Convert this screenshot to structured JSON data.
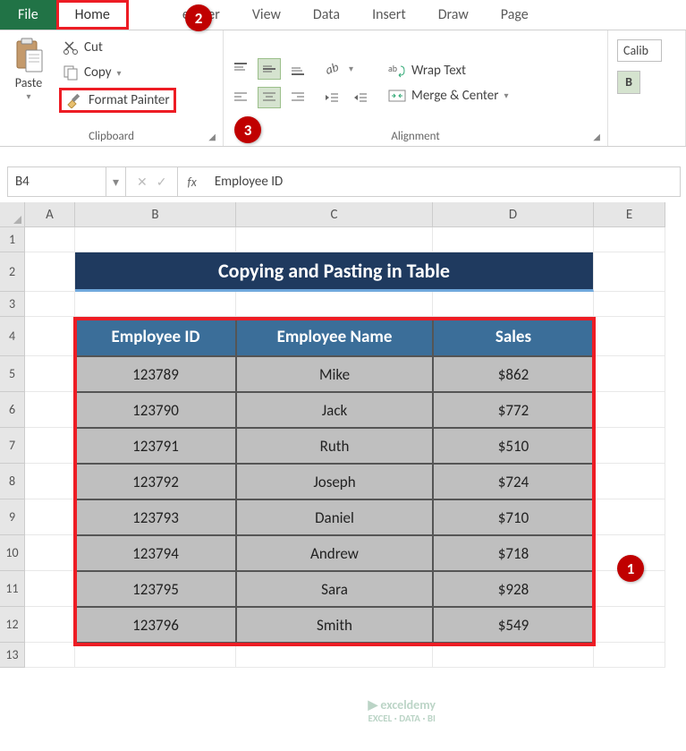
{
  "tabs": {
    "file": "File",
    "home": "Home",
    "developer": "eloper",
    "view": "View",
    "data": "Data",
    "insert": "Insert",
    "draw": "Draw",
    "page": "Page"
  },
  "clipboard": {
    "paste": "Paste",
    "cut": "Cut",
    "copy": "Copy",
    "formatPainter": "Format Painter",
    "groupLabel": "Clipboard"
  },
  "alignment": {
    "wrapText": "Wrap Text",
    "mergeCenter": "Merge & Center",
    "groupLabel": "Alignment"
  },
  "font": {
    "name": "Calib",
    "bold": "B"
  },
  "nameBox": "B4",
  "formulaValue": "Employee ID",
  "columns": [
    "A",
    "B",
    "C",
    "D",
    "E"
  ],
  "rowNumbers": [
    "1",
    "2",
    "3",
    "4",
    "5",
    "6",
    "7",
    "8",
    "9",
    "10",
    "11",
    "12",
    "13"
  ],
  "titleText": "Copying and Pasting in Table",
  "tableHeaders": {
    "id": "Employee ID",
    "name": "Employee Name",
    "sales": "Sales"
  },
  "tableData": [
    {
      "id": "123789",
      "name": "Mike",
      "sales": "$862"
    },
    {
      "id": "123790",
      "name": "Jack",
      "sales": "$772"
    },
    {
      "id": "123791",
      "name": "Ruth",
      "sales": "$510"
    },
    {
      "id": "123792",
      "name": "Joseph",
      "sales": "$724"
    },
    {
      "id": "123793",
      "name": "Daniel",
      "sales": "$710"
    },
    {
      "id": "123794",
      "name": "Andrew",
      "sales": "$718"
    },
    {
      "id": "123795",
      "name": "Sara",
      "sales": "$928"
    },
    {
      "id": "123796",
      "name": "Smith",
      "sales": "$549"
    }
  ],
  "callouts": {
    "c1": "1",
    "c2": "2",
    "c3": "3"
  },
  "watermark": {
    "line1": "exceldemy",
    "line2": "EXCEL · DATA · BI"
  }
}
